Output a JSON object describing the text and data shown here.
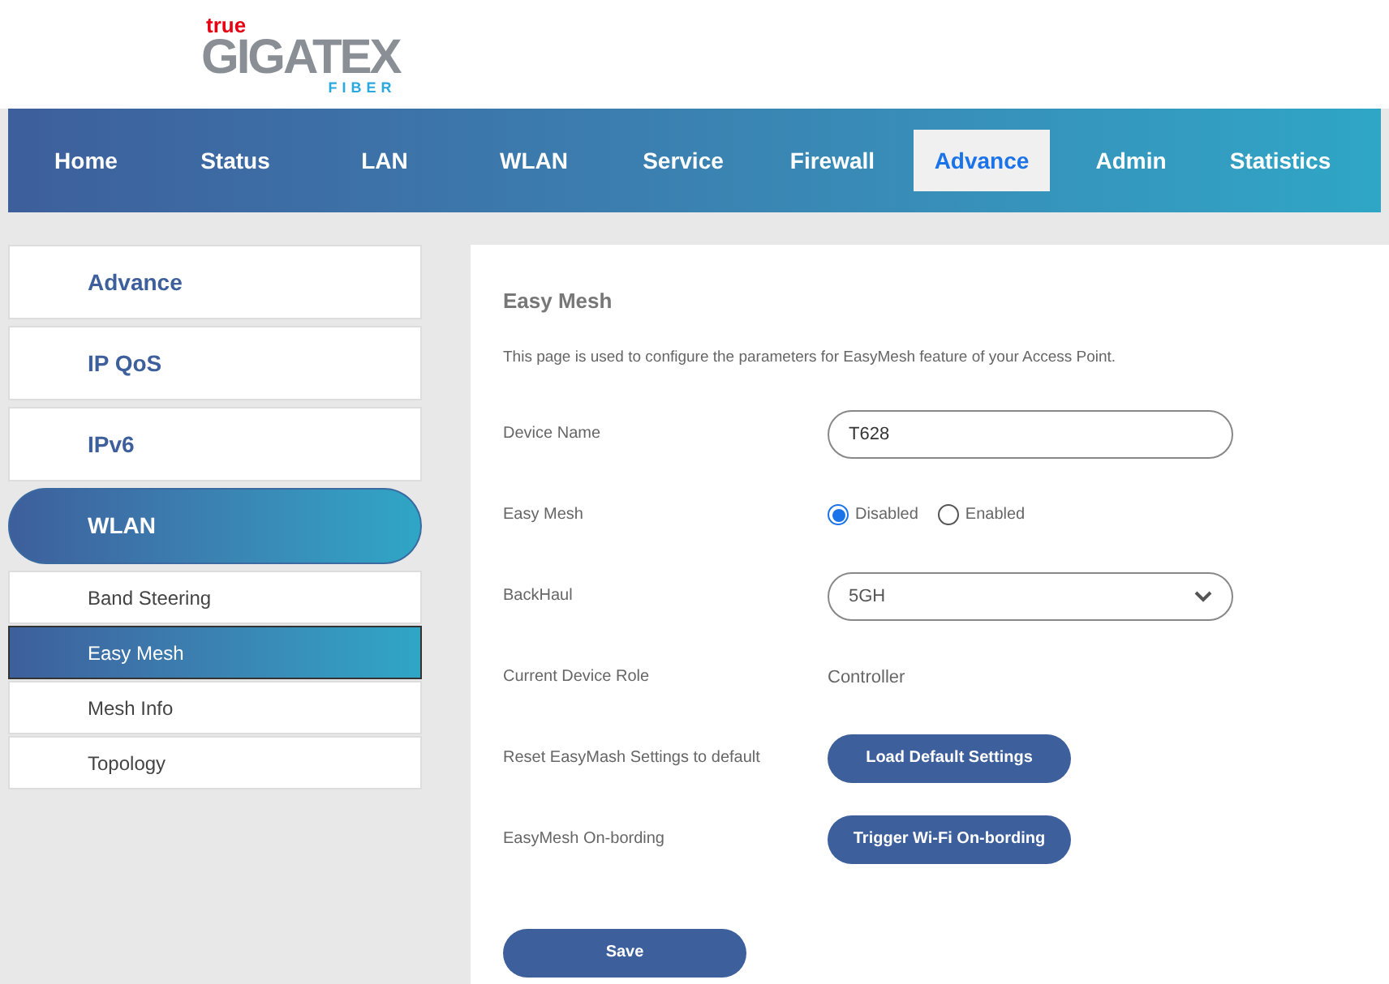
{
  "logo": {
    "brand": "true",
    "name": "GIGATEX",
    "tagline": "FIBER"
  },
  "nav": [
    {
      "label": "Home",
      "selected": false
    },
    {
      "label": "Status",
      "selected": false
    },
    {
      "label": "LAN",
      "selected": false
    },
    {
      "label": "WLAN",
      "selected": false
    },
    {
      "label": "Service",
      "selected": false
    },
    {
      "label": "Firewall",
      "selected": false
    },
    {
      "label": "Advance",
      "selected": true
    },
    {
      "label": "Admin",
      "selected": false
    },
    {
      "label": "Statistics",
      "selected": false
    }
  ],
  "sidebar": {
    "items": [
      {
        "kind": "section",
        "label": "Advance",
        "selected": false
      },
      {
        "kind": "section",
        "label": "IP QoS",
        "selected": false
      },
      {
        "kind": "section",
        "label": "IPv6",
        "selected": false
      },
      {
        "kind": "section",
        "label": "WLAN",
        "selected": true
      },
      {
        "kind": "sub",
        "label": "Band Steering",
        "selected": false
      },
      {
        "kind": "sub",
        "label": "Easy Mesh",
        "selected": true
      },
      {
        "kind": "sub",
        "label": "Mesh Info",
        "selected": false
      },
      {
        "kind": "sub",
        "label": "Topology",
        "selected": false
      }
    ]
  },
  "content": {
    "title": "Easy Mesh",
    "description": "This page is used to configure the parameters for EasyMesh feature of your Access Point.",
    "rows": [
      {
        "kind": "text-input",
        "label": "Device Name",
        "value": "T628"
      },
      {
        "kind": "radio",
        "label": "Easy Mesh",
        "options": [
          {
            "label": "Disabled",
            "selected": true
          },
          {
            "label": "Enabled",
            "selected": false
          }
        ]
      },
      {
        "kind": "select",
        "label": "BackHaul",
        "value": "5GH"
      },
      {
        "kind": "text",
        "label": "Current Device Role",
        "value": "Controller"
      },
      {
        "kind": "button",
        "label": "Reset EasyMash Settings to default",
        "value": "Load Default Settings"
      },
      {
        "kind": "button",
        "label": "EasyMesh On-bording",
        "value": "Trigger Wi-Fi On-bording"
      }
    ],
    "save": "Save"
  }
}
